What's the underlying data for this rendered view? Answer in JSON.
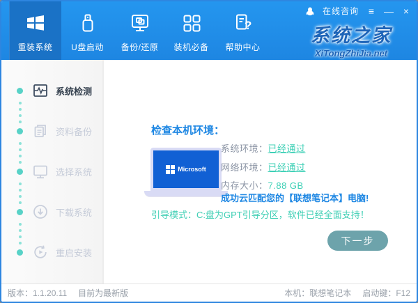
{
  "titlebar": {
    "consult": "在线咨询",
    "menu_glyph": "≡",
    "minimize_glyph": "—",
    "close_glyph": "×"
  },
  "logo": {
    "title": "系统之家",
    "subtitle": "XiTongZhiJia.net"
  },
  "nav": {
    "items": [
      {
        "label": "重装系统",
        "active": true
      },
      {
        "label": "U盘启动",
        "active": false
      },
      {
        "label": "备份/还原",
        "active": false
      },
      {
        "label": "装机必备",
        "active": false
      },
      {
        "label": "帮助中心",
        "active": false
      }
    ]
  },
  "sidebar": {
    "steps": [
      {
        "label": "系统检测",
        "active": true
      },
      {
        "label": "资料备份",
        "active": false
      },
      {
        "label": "选择系统",
        "active": false
      },
      {
        "label": "下载系统",
        "active": false
      },
      {
        "label": "重启安装",
        "active": false
      }
    ]
  },
  "main": {
    "heading": "检查本机环境：",
    "laptop_brand": "Microsoft",
    "checks": [
      {
        "label": "系统环境：",
        "value": "已经通过"
      },
      {
        "label": "网络环境：",
        "value": "已经通过"
      },
      {
        "label": "内存大小：",
        "value": "7.88 GB"
      }
    ],
    "match_message": "成功云匹配您的【联想笔记本】电脑!",
    "boot_mode": "引导模式：C:盘为GPT引导分区，软件已经全面支持！",
    "next_button": "下一步"
  },
  "statusbar": {
    "version": "版本：1.1.20.11",
    "latest": "目前为最新版",
    "machine": "本机：联想笔记本",
    "boot_key": "启动键：F12"
  },
  "icons": {
    "question_mark": "?"
  },
  "colors": {
    "header_blue": "#1e8fe9",
    "active_tab_blue": "#1a72c6",
    "accent_teal": "#3ed0b6",
    "accent_blue": "#1e87e3",
    "button_teal": "#6da3ab",
    "logo_blue": "#1d64b8"
  }
}
